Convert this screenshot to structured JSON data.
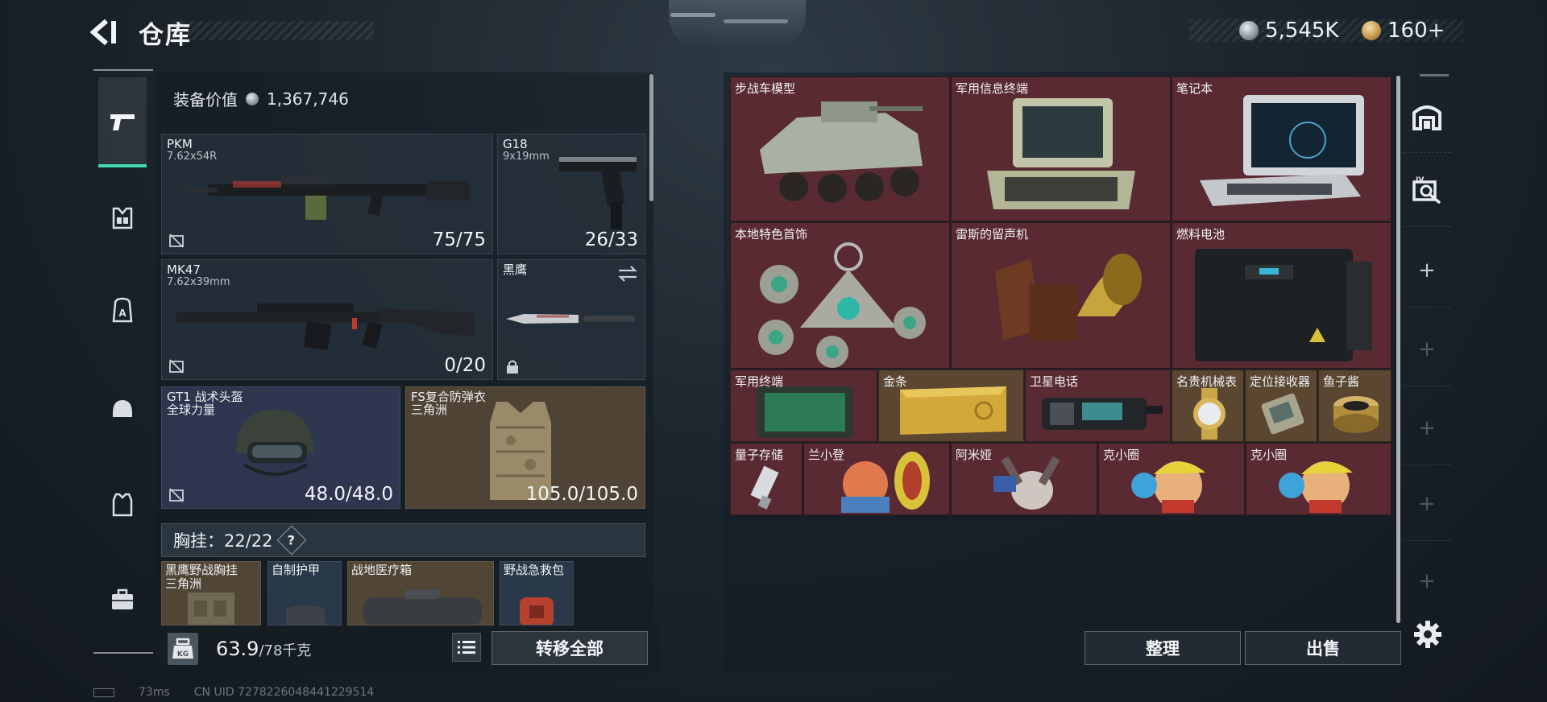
{
  "header": {
    "title": "仓库",
    "currency_silver": "5,545K",
    "currency_gold": "160+"
  },
  "loadout": {
    "equip_value_label": "装备价值",
    "equip_value": "1,367,746",
    "slots": {
      "pkm": {
        "name": "PKM",
        "caliber": "7.62x54R",
        "count": "75/75"
      },
      "g18": {
        "name": "G18",
        "caliber": "9x19mm",
        "count": "26/33"
      },
      "mk47": {
        "name": "MK47",
        "caliber": "7.62x39mm",
        "count": "0/20"
      },
      "knife": {
        "name": "黑鹰"
      },
      "helmet": {
        "name": "GT1 战术头盔",
        "sub": "全球力量",
        "durability": "48.0/48.0"
      },
      "armor": {
        "name": "FS复合防弹衣",
        "sub": "三角洲",
        "durability": "105.0/105.0"
      }
    },
    "chest_rig": "胸挂：22/22",
    "chest_help": "?",
    "mini_items": [
      {
        "name": "黑鹰野战胸挂",
        "sub": "三角洲"
      },
      {
        "name": "自制护甲"
      },
      {
        "name": "战地医疗箱"
      },
      {
        "name": "野战急救包"
      }
    ],
    "weight": "63.9",
    "weight_cap": "/78千克",
    "transfer_all": "转移全部"
  },
  "status": {
    "ping": "73ms",
    "uid": "CN UID 7278226048441229514"
  },
  "storage": {
    "items": [
      {
        "name": "步战车模型"
      },
      {
        "name": "军用信息终端"
      },
      {
        "name": "笔记本"
      },
      {
        "name": "本地特色首饰"
      },
      {
        "name": "雷斯的留声机"
      },
      {
        "name": "燃料电池"
      },
      {
        "name": "军用终端"
      },
      {
        "name": "金条"
      },
      {
        "name": "卫星电话"
      },
      {
        "name": "名贵机械表"
      },
      {
        "name": "定位接收器"
      },
      {
        "name": "鱼子酱"
      },
      {
        "name": "量子存储"
      },
      {
        "name": "兰小登"
      },
      {
        "name": "阿米娅"
      },
      {
        "name": "克小圈"
      },
      {
        "name": "克小圈"
      }
    ],
    "sort": "整理",
    "sell": "出售"
  },
  "colors": {
    "accent": "#3fdcb0",
    "item_red": "#5a2a33",
    "item_gold": "#5b4632"
  }
}
